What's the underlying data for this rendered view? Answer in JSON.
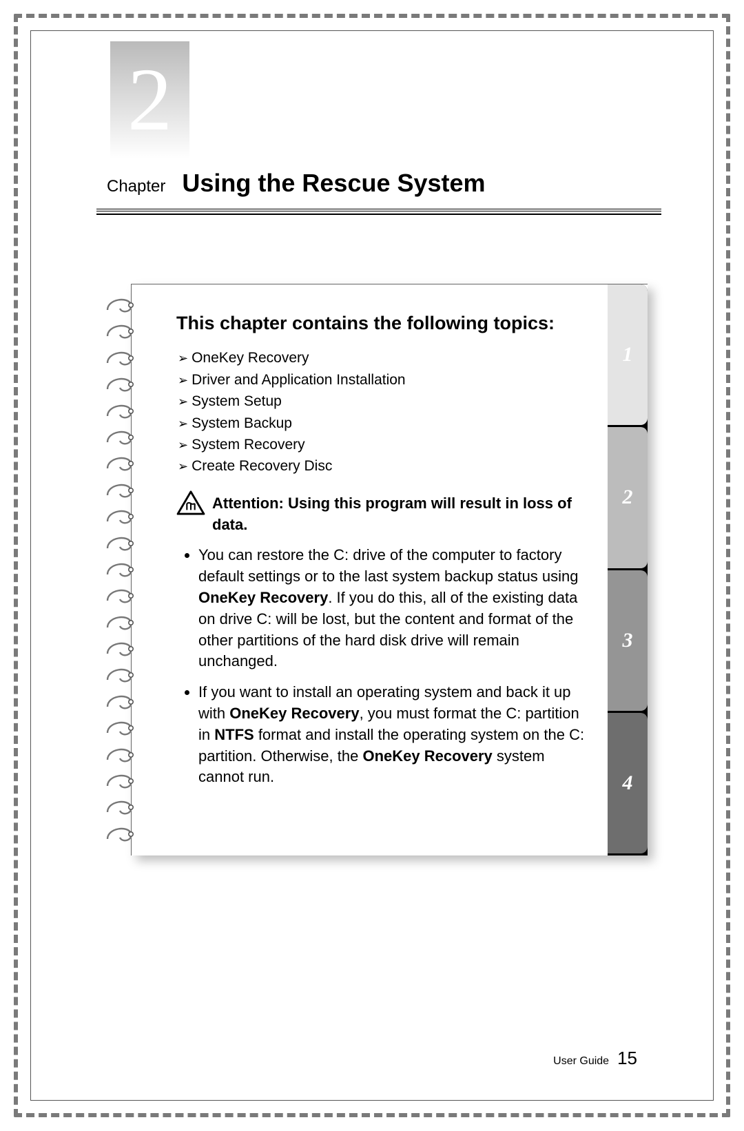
{
  "chapter": {
    "number": "2",
    "label": "Chapter",
    "title": "Using the Rescue System"
  },
  "topics": {
    "heading": "This chapter contains the following topics:",
    "items": [
      "OneKey Recovery",
      "Driver and Application Installation",
      "System Setup",
      "System Backup",
      "System Recovery",
      "Create Recovery Disc"
    ]
  },
  "attention": {
    "text": "Attention: Using this program will result in loss of data."
  },
  "bullets": [
    {
      "pre": "You can restore the C: drive of the computer to factory default settings or to the last system backup status using ",
      "bold1": "OneKey Recovery",
      "post": ". If you do this, all of the existing data on drive C: will be lost, but the content and format of the other partitions of the hard disk drive will remain unchanged."
    },
    {
      "pre": "If you want to install an operating system and back it up with ",
      "bold1": "OneKey Recovery",
      "mid1": ", you must format the C: partition in ",
      "bold2": "NTFS",
      "mid2": " format and install the operating system on the C: partition. Otherwise, the ",
      "bold3": "OneKey Recovery",
      "post": " system cannot run."
    }
  ],
  "tabs": [
    "1",
    "2",
    "3",
    "4"
  ],
  "footer": {
    "label": "User Guide",
    "page": "15"
  }
}
